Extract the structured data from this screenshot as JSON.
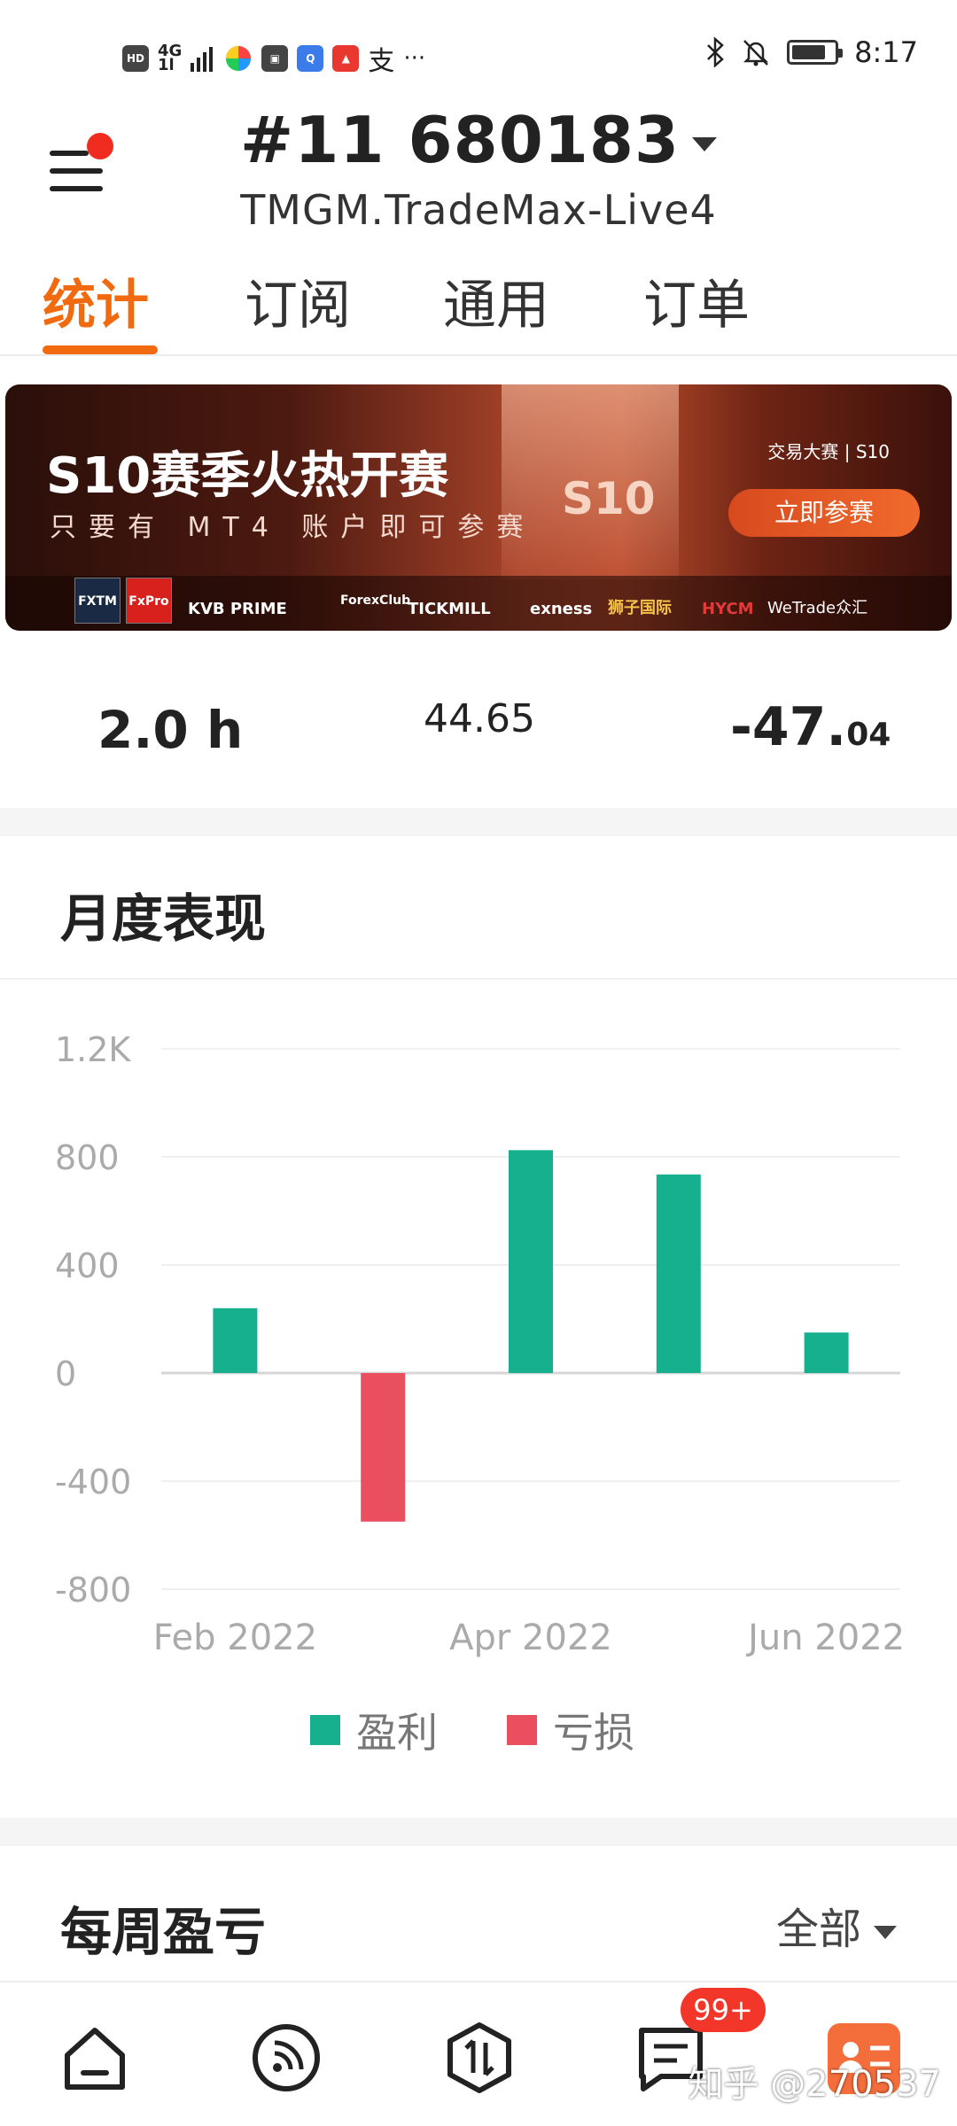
{
  "status_bar": {
    "left_icons": [
      "HD",
      "4G",
      "signal",
      "app-multi",
      "huawei-store",
      "browser",
      "huawei-mall",
      "alipay",
      "more"
    ],
    "alipay_glyph": "支",
    "more_glyph": "···",
    "right_icons": [
      "bluetooth-icon",
      "mute-icon",
      "battery-icon"
    ],
    "battery_level": 0.8,
    "time": "8:17"
  },
  "header": {
    "account_number": "#11  680183",
    "server": "TMGM.TradeMax-Live4"
  },
  "tabs": [
    {
      "label": "统计",
      "active": true
    },
    {
      "label": "订阅",
      "active": false
    },
    {
      "label": "通用",
      "active": false
    },
    {
      "label": "订单",
      "active": false
    }
  ],
  "banner": {
    "title": "S10赛季火热开赛",
    "subtitle": "只要有 MT4 账户即可参赛",
    "tag": "交易大赛 | S10",
    "stage_text": "S10",
    "cta": "立即参赛",
    "brands": [
      "FXTM",
      "FxPro",
      "KVB PRIME",
      "ForexClub",
      "TICKMILL",
      "exness",
      "狮子国际",
      "HYCM",
      "WeTrade众汇"
    ]
  },
  "stats": {
    "avg_hold": "2.0 h",
    "value_mid": "44.65",
    "value_right_int": "-47.",
    "value_right_dec": "04"
  },
  "monthly": {
    "title": "月度表现"
  },
  "chart_data": {
    "type": "bar",
    "x_ticks": [
      "Feb 2022",
      "Apr 2022",
      "Jun 2022"
    ],
    "categories": [
      "Feb 2022",
      "Mar 2022",
      "Apr 2022",
      "May 2022",
      "Jun 2022"
    ],
    "values": [
      240,
      -550,
      825,
      735,
      150
    ],
    "ylim": [
      -800,
      1200
    ],
    "y_ticks": [
      "1.2K",
      "800",
      "400",
      "0",
      "-400",
      "-800"
    ],
    "y_tick_values": [
      1200,
      800,
      400,
      0,
      -400,
      -800
    ],
    "positive_color": "#16b08e",
    "negative_color": "#e94f5f",
    "grid": true,
    "legend": [
      {
        "name": "盈利",
        "color": "#16b08e"
      },
      {
        "name": "亏损",
        "color": "#e94f5f"
      }
    ]
  },
  "weekly": {
    "title": "每周盈亏",
    "filter": "全部"
  },
  "bottom_nav": {
    "items": [
      "home-icon",
      "feed-icon",
      "trade-icon",
      "messages-icon",
      "profile-icon"
    ],
    "badge": "99+"
  },
  "watermark": "知乎 @270537"
}
